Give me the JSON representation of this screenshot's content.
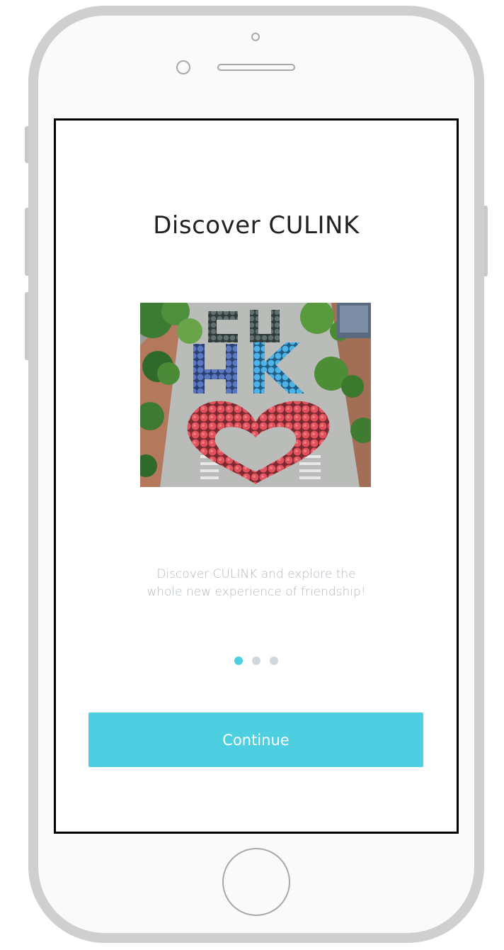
{
  "onboarding": {
    "title": "Discover CULINK",
    "description_line1": "Discover CULINK and explore the",
    "description_line2": "whole new experience of friendship!",
    "hero_image": {
      "subject": "aerial photo of people with umbrellas forming letters and a heart"
    },
    "pagination": {
      "total": 3,
      "active_index": 0
    },
    "continue_label": "Continue"
  },
  "colors": {
    "accent": "#4dcfe1",
    "title": "#222222",
    "description": "#b2bac0",
    "dot_inactive": "#d2d7db",
    "phone_frame": "#cfcfcf"
  },
  "icons": {
    "pagination_dot": "dot"
  }
}
